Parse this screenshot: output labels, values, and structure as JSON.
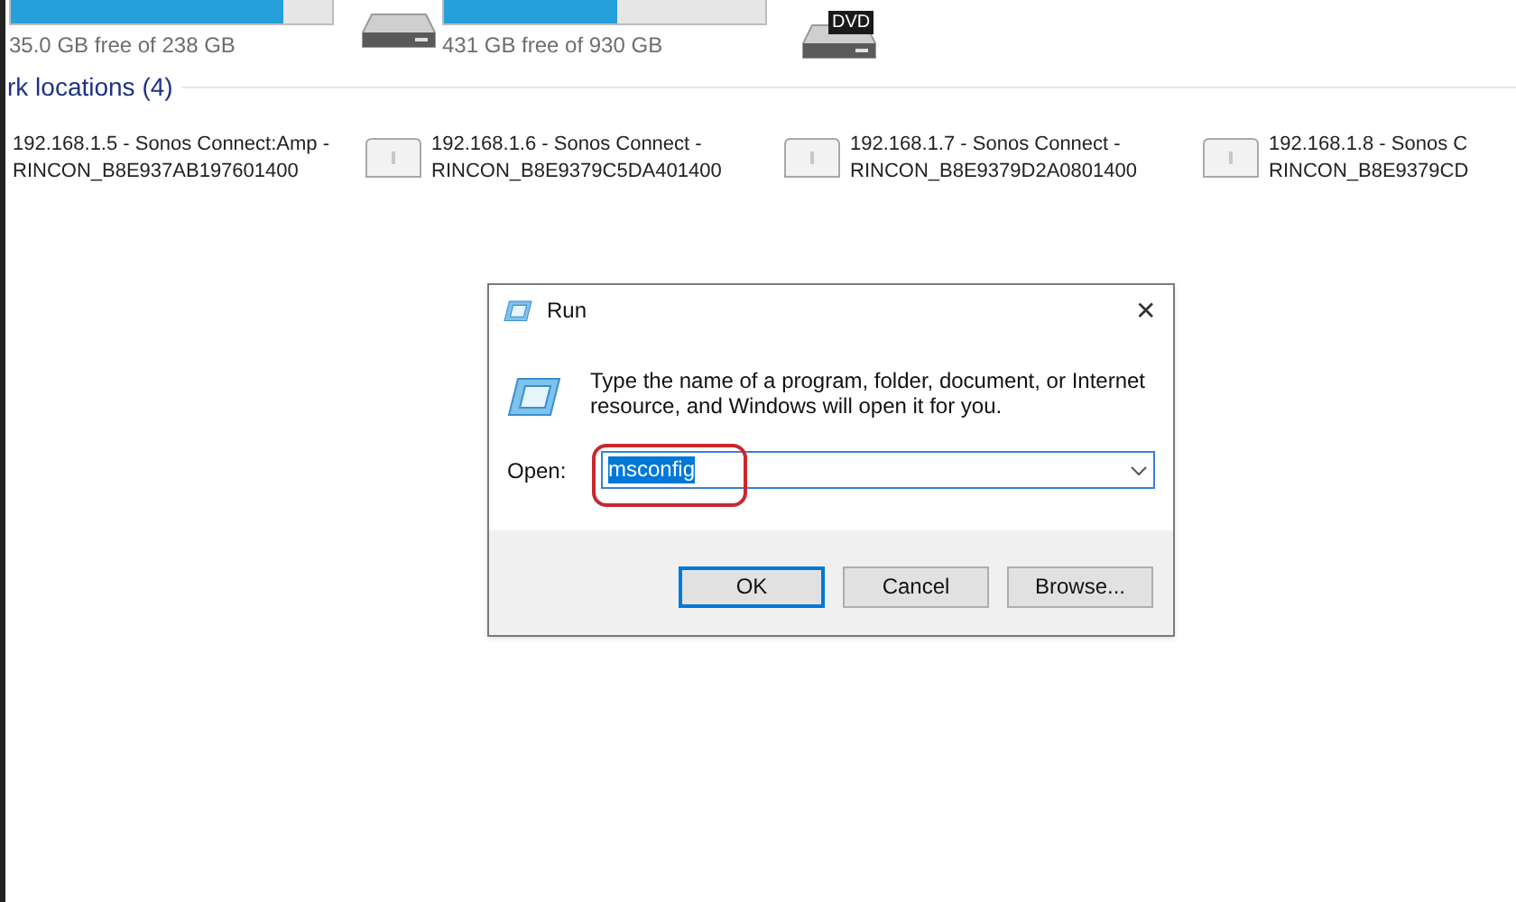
{
  "drives": [
    {
      "level": 0.85,
      "free": "35.0 GB free of 238 GB"
    },
    {
      "level": 0.54,
      "free": "431 GB free of 930 GB"
    }
  ],
  "dvd": {
    "badge": "DVD"
  },
  "network": {
    "heading": "rk locations (4)",
    "items": [
      {
        "line1": "192.168.1.5 - Sonos Connect:Amp -",
        "line2": "RINCON_B8E937AB197601400"
      },
      {
        "line1": "192.168.1.6 - Sonos Connect -",
        "line2": "RINCON_B8E9379C5DA401400"
      },
      {
        "line1": "192.168.1.7 - Sonos Connect -",
        "line2": "RINCON_B8E9379D2A0801400"
      },
      {
        "line1": "192.168.1.8 - Sonos C",
        "line2": "RINCON_B8E9379CD"
      }
    ]
  },
  "run_dialog": {
    "title": "Run",
    "close": "✕",
    "description": "Type the name of a program, folder, document, or Internet resource, and Windows will open it for you.",
    "open_label": "Open:",
    "value": "msconfig",
    "buttons": [
      "OK",
      "Cancel",
      "Browse..."
    ]
  }
}
